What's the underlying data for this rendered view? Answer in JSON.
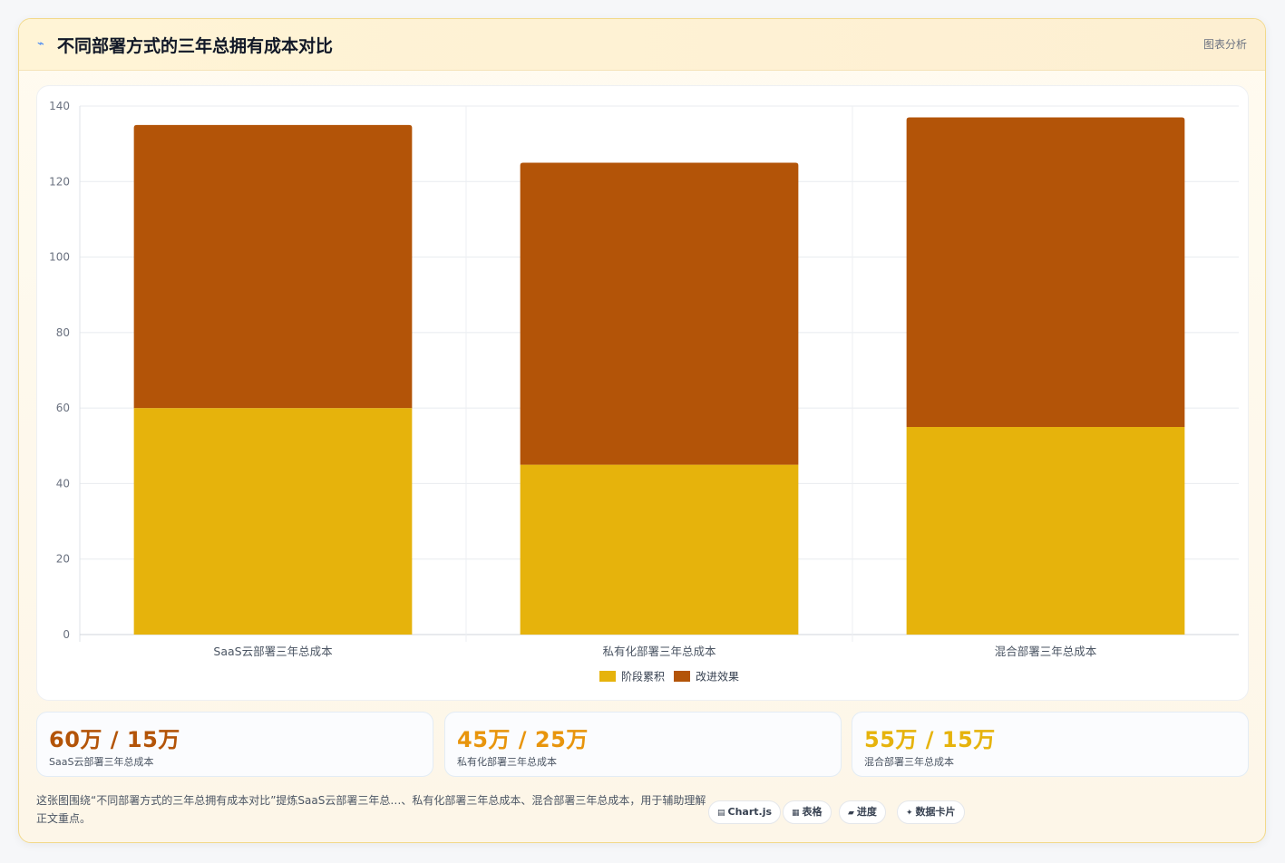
{
  "header": {
    "icon": "chart-line-icon",
    "title": "不同部署方式的三年总拥有成本对比",
    "action": "图表分析"
  },
  "chart_data": {
    "type": "bar",
    "stacked": true,
    "categories": [
      "SaaS云部署三年总成本",
      "私有化部署三年总成本",
      "混合部署三年总成本"
    ],
    "series": [
      {
        "name": "阶段累积",
        "color": "#e6b30c",
        "values": [
          60,
          45,
          55
        ]
      },
      {
        "name": "改进效果",
        "color": "#b35408",
        "values": [
          75,
          80,
          82
        ]
      }
    ],
    "ylim": [
      0,
      140
    ],
    "yticks": [
      0,
      20,
      40,
      60,
      80,
      100,
      120,
      140
    ],
    "grid": true,
    "legend": "bottom"
  },
  "stats": [
    {
      "value": "60万 / 15万",
      "label": "SaaS云部署三年总成本",
      "color": "#b35408"
    },
    {
      "value": "45万 / 25万",
      "label": "私有化部署三年总成本",
      "color": "#e8950c"
    },
    {
      "value": "55万 / 15万",
      "label": "混合部署三年总成本",
      "color": "#e6b30c"
    }
  ],
  "summary": "这张图围绕“不同部署方式的三年总拥有成本对比”提炼SaaS云部署三年总…、私有化部署三年总成本、混合部署三年总成本，用于辅助理解正文重点。",
  "tags": [
    {
      "icon": "chart-icon",
      "glyph": "▤",
      "label": "Chart.js"
    },
    {
      "icon": "table-icon",
      "glyph": "▦",
      "label": "表格"
    },
    {
      "icon": "progress-icon",
      "glyph": "▰",
      "label": "进度"
    },
    {
      "icon": "data-card-icon",
      "glyph": "✦",
      "label": "数据卡片"
    }
  ]
}
